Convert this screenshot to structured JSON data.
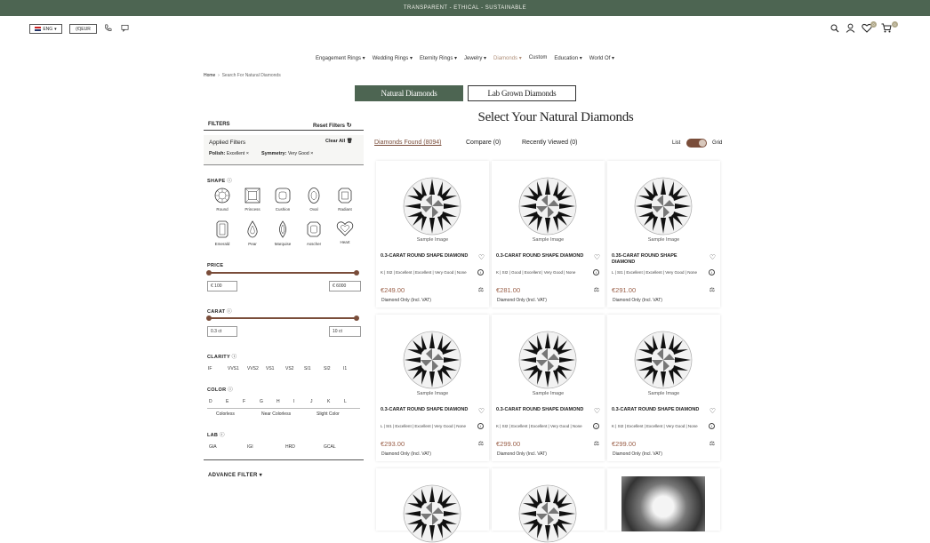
{
  "topbar": {
    "text": "TRANSPARENT - ETHICAL - SUSTAINABLE"
  },
  "header": {
    "language": "ENG",
    "currency": "(€)EUR",
    "wishlist_count": "0",
    "cart_count": "0"
  },
  "nav": {
    "items": [
      {
        "label": "Engagement Rings",
        "arrow": "▾"
      },
      {
        "label": "Wedding Rings",
        "arrow": "▾"
      },
      {
        "label": "Eternity Rings",
        "arrow": "▾"
      },
      {
        "label": "Jewelry",
        "arrow": "▾"
      },
      {
        "label": "Diamonds",
        "arrow": "▾",
        "active": true
      },
      {
        "label": "Custom",
        "arrow": ""
      },
      {
        "label": "Education",
        "arrow": "▾"
      },
      {
        "label": "World Of",
        "arrow": "▾"
      }
    ]
  },
  "breadcrumb": {
    "home": "Home",
    "sep": "›",
    "current": "Search For Natural Diamonds"
  },
  "tabs": {
    "natural": "Natural Diamonds",
    "lab": "Lab Grown Diamonds"
  },
  "page_title": "Select Your Natural Diamonds",
  "filters": {
    "title": "FILTERS",
    "reset": "Reset Filters",
    "applied_title": "Applied Filters",
    "clear_all": "Clear All",
    "polish_label": "Polish:",
    "polish_value": "Excellent",
    "symmetry_label": "Symmetry:",
    "symmetry_value": "Very Good",
    "remove": "×",
    "shape_label": "SHAPE",
    "shapes": [
      "Round",
      "Princess",
      "Cushion",
      "Oval",
      "Radiant",
      "Emerald",
      "Pear",
      "Marquise",
      "Asscher",
      "Heart"
    ],
    "price_label": "PRICE",
    "price_min": "€ 100",
    "price_max": "€ 6000",
    "carat_label": "CARAT",
    "carat_min": "0.3 ct",
    "carat_max": "10 ct",
    "clarity_label": "CLARITY",
    "clarity": [
      "IF",
      "VVS1",
      "VVS2",
      "VS1",
      "VS2",
      "SI1",
      "SI2",
      "I1"
    ],
    "color_label": "COLOR",
    "colors": [
      "D",
      "E",
      "F",
      "G",
      "H",
      "I",
      "J",
      "K",
      "L"
    ],
    "color_groups": [
      "Colorless",
      "Near Colorless",
      "Slight Color"
    ],
    "lab_label": "LAB",
    "labs": [
      "GIA",
      "IGI",
      "HRD",
      "GCAL"
    ],
    "advance": "ADVANCE FILTER"
  },
  "results": {
    "found": "Diamonds Found (8094)",
    "compare": "Compare (0)",
    "recent": "Recently Viewed (0)",
    "list": "List",
    "grid": "Grid"
  },
  "cards": [
    {
      "name": "0.3-CARAT ROUND SHAPE DIAMOND",
      "spec": "K | SI2 | Excellent | Excellent | Very Good | None",
      "price": "€249.00",
      "sample": "Sample Image",
      "vat": "Diamond Only (Incl. VAT)"
    },
    {
      "name": "0.3-CARAT ROUND SHAPE DIAMOND",
      "spec": "K | SI2 | Good | Excellent | Very Good | None",
      "price": "€281.00",
      "sample": "Sample Image",
      "vat": "Diamond Only (Incl. VAT)"
    },
    {
      "name": "0.35-CARAT ROUND SHAPE DIAMOND",
      "spec": "L | SI1 | Excellent | Excellent | Very Good | None",
      "price": "€291.00",
      "sample": "Sample Image",
      "vat": "Diamond Only (Incl. VAT)"
    },
    {
      "name": "0.3-CARAT ROUND SHAPE DIAMOND",
      "spec": "L | SI1 | Excellent | Excellent | Very Good | None",
      "price": "€293.00",
      "sample": "Sample Image",
      "vat": "Diamond Only (Incl. VAT)"
    },
    {
      "name": "0.3-CARAT ROUND SHAPE DIAMOND",
      "spec": "K | SI2 | Excellent | Excellent | Very Good | None",
      "price": "€299.00",
      "sample": "Sample Image",
      "vat": "Diamond Only (Incl. VAT)"
    },
    {
      "name": "0.3-CARAT ROUND SHAPE DIAMOND",
      "spec": "K | SI2 | Excellent | Excellent | Very Good | None",
      "price": "€299.00",
      "sample": "Sample Image",
      "vat": "Diamond Only (Incl. VAT)"
    }
  ]
}
